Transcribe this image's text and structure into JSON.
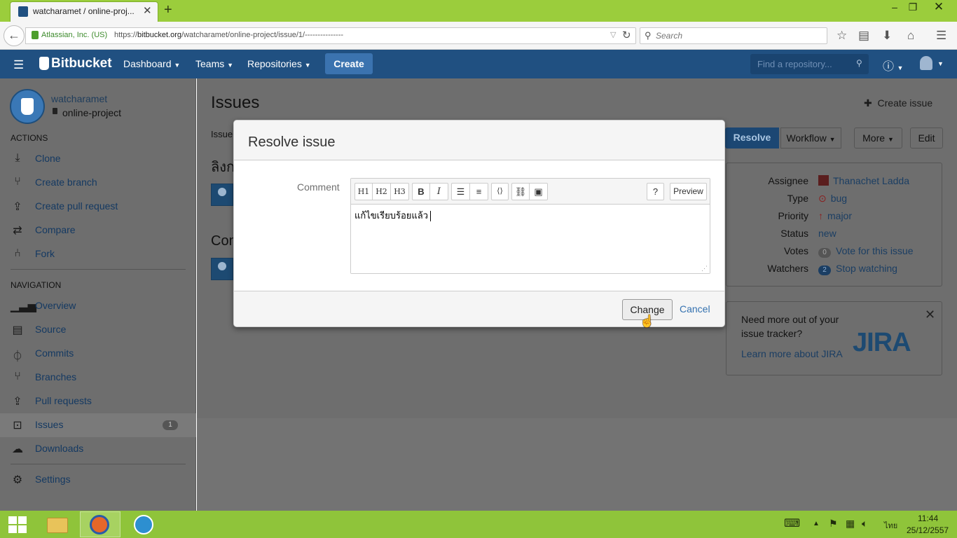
{
  "browser": {
    "tab_title": "watcharamet / online-proj...",
    "site_identity": "Atlassian, Inc. (US)",
    "url_prefix": "https://",
    "url_domain": "bitbucket.org",
    "url_path": "/watcharamet/online-project/issue/1/---------------",
    "search_placeholder": "Search"
  },
  "header": {
    "logo": "Bitbucket",
    "nav": [
      "Dashboard",
      "Teams",
      "Repositories"
    ],
    "create_label": "Create",
    "repo_search_placeholder": "Find a repository..."
  },
  "sidebar": {
    "owner": "watcharamet",
    "repo": "online-project",
    "actions_heading": "ACTIONS",
    "actions": [
      {
        "label": "Clone",
        "icon": "clone-icon"
      },
      {
        "label": "Create branch",
        "icon": "branch-icon"
      },
      {
        "label": "Create pull request",
        "icon": "pull-request-icon"
      },
      {
        "label": "Compare",
        "icon": "compare-icon"
      },
      {
        "label": "Fork",
        "icon": "fork-icon"
      }
    ],
    "navigation_heading": "NAVIGATION",
    "navigation": [
      {
        "label": "Overview",
        "icon": "overview-icon"
      },
      {
        "label": "Source",
        "icon": "source-icon"
      },
      {
        "label": "Commits",
        "icon": "commits-icon"
      },
      {
        "label": "Branches",
        "icon": "branches-icon"
      },
      {
        "label": "Pull requests",
        "icon": "pull-requests-icon"
      },
      {
        "label": "Issues",
        "icon": "issues-icon",
        "count": "1"
      },
      {
        "label": "Downloads",
        "icon": "downloads-icon"
      }
    ],
    "settings": "Settings"
  },
  "main": {
    "title": "Issues",
    "create_issue": "Create issue",
    "crumb": "Issue",
    "issue_title_partial": "ลิงก",
    "comments_partial": "Com",
    "buttons": {
      "resolve": "Resolve",
      "workflow": "Workflow",
      "more": "More",
      "edit": "Edit"
    },
    "meta": [
      {
        "label": "Assignee",
        "value": "Thanachet Ladda"
      },
      {
        "label": "Type",
        "value": "bug"
      },
      {
        "label": "Priority",
        "value": "major"
      },
      {
        "label": "Status",
        "value": "new"
      },
      {
        "label": "Votes",
        "count": "0",
        "value": "Vote for this issue"
      },
      {
        "label": "Watchers",
        "count": "2",
        "value": "Stop watching"
      }
    ],
    "jira": {
      "text_line1": "Need more out of your",
      "text_line2": "issue tracker?",
      "link": "Learn more about JIRA",
      "logo": "JIRA"
    }
  },
  "dialog": {
    "title": "Resolve issue",
    "comment_label": "Comment",
    "toolbar": {
      "h1": "H1",
      "h2": "H2",
      "h3": "H3",
      "bold": "B",
      "italic": "I",
      "preview": "Preview"
    },
    "comment_value": "แก้ไขเรียบร้อยแล้ว",
    "change_label": "Change",
    "cancel_label": "Cancel"
  },
  "taskbar": {
    "lang": "ไทย",
    "time": "11:44",
    "date": "25/12/2557"
  },
  "colors": {
    "bitbucket_blue": "#205081",
    "link_blue": "#3572b0",
    "taskbar_green": "#8fc43a"
  }
}
